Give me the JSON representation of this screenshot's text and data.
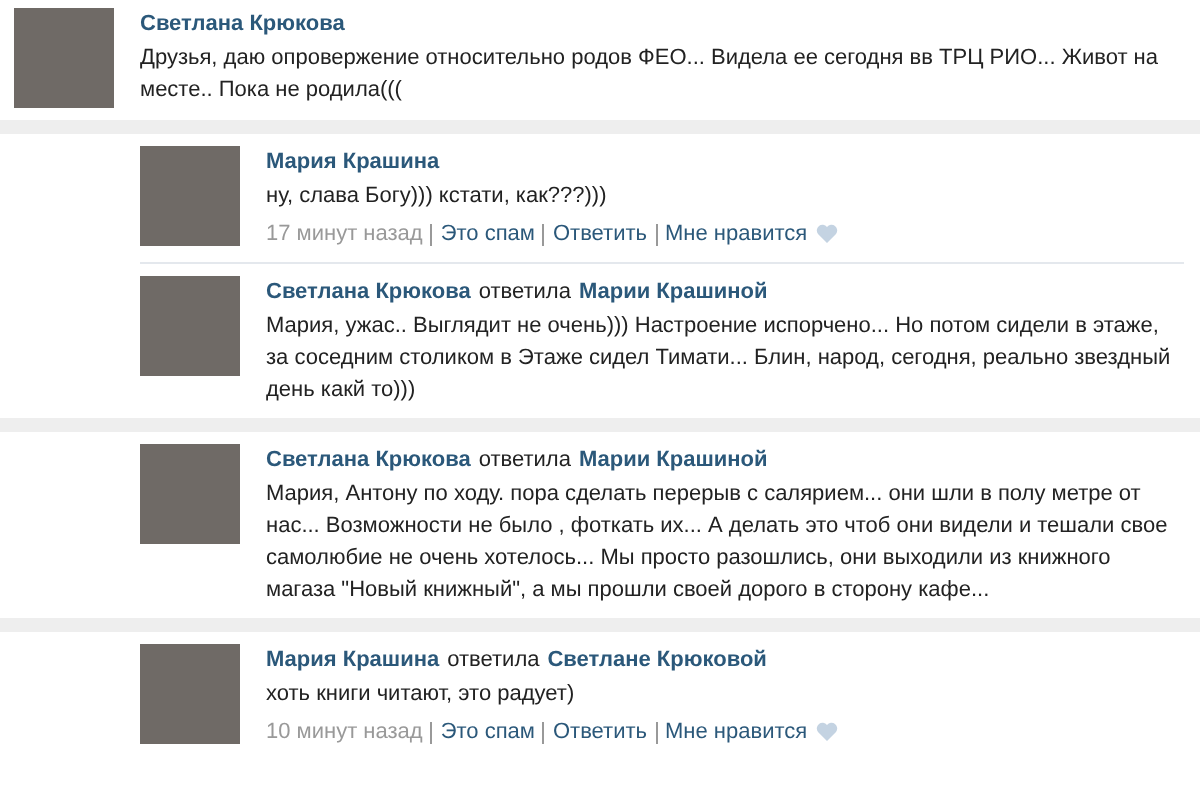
{
  "comments": [
    {
      "kind": "post",
      "author": "Светлана Крюкова",
      "text": "Друзья, даю опровержение относительно родов ФЕО... Видела ее сегодня вв ТРЦ РИО... Живот на месте.. Пока не родила((("
    },
    {
      "kind": "reply",
      "author": "Мария Крашина",
      "text": "ну, слава Богу))) кстати, как???)))",
      "footer": {
        "time": "17 минут назад",
        "links": [
          "Это спам",
          "Ответить",
          "Мне нравится"
        ]
      }
    },
    {
      "kind": "reply",
      "author": "Светлана Крюкова",
      "verb": "ответила",
      "reply_to": "Марии Крашиной",
      "text": "Мария, ужас.. Выглядит не очень))) Настроение испорчено... Но потом сидели в этаже, за соседним столиком в Этаже сидел Тимати... Блин, народ, сегодня, реально звездный день какй то)))"
    },
    {
      "kind": "reply",
      "author": "Светлана Крюкова",
      "verb": "ответила",
      "reply_to": "Марии Крашиной",
      "text": "Мария, Антону по ходу. пора сделать перерыв с салярием... они шли в полу метре от нас... Возможности не было , фоткать их... А делать это чтоб они видели и тешали свое самолюбие не очень хотелось... Мы просто разошлись, они выходили из книжного магаза \"Новый книжный\", а мы прошли своей дорого в сторону кафе..."
    },
    {
      "kind": "reply",
      "author": "Мария Крашина",
      "verb": "ответила",
      "reply_to": "Светлане Крюковой",
      "text": "хоть книги читают, это радует)",
      "footer": {
        "time": "10 минут назад",
        "links": [
          "Это спам",
          "Ответить",
          "Мне нравится"
        ]
      }
    }
  ]
}
